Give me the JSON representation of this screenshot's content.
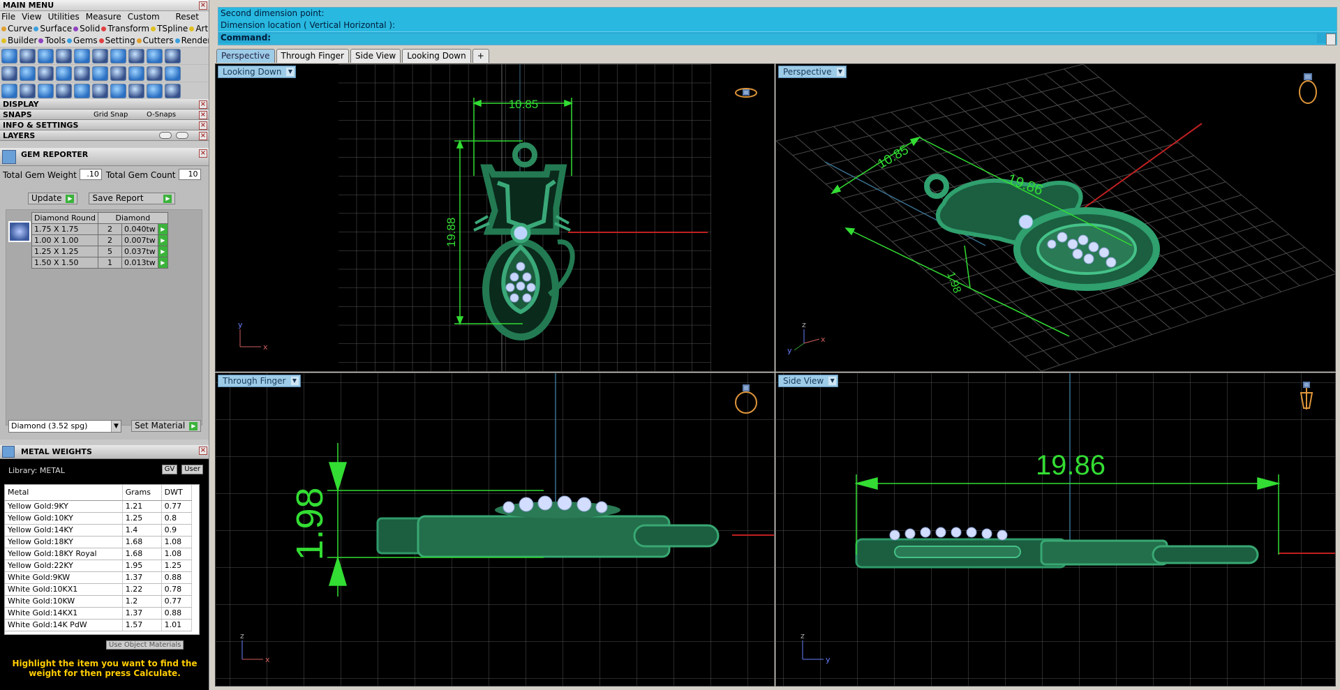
{
  "main_menu": {
    "title": "MAIN MENU",
    "menus": [
      "File",
      "View",
      "Utilities",
      "Measure",
      "Custom"
    ],
    "reset": "Reset",
    "tags_row1": [
      {
        "label": "Curve",
        "color": "#e0a030"
      },
      {
        "label": "Surface",
        "color": "#3aa0e0"
      },
      {
        "label": "Solid",
        "color": "#9040c0"
      },
      {
        "label": "Transform",
        "color": "#e04040"
      },
      {
        "label": "TSpline",
        "color": "#e0c020"
      },
      {
        "label": "Art",
        "color": "#e0c020"
      }
    ],
    "tags_row2": [
      {
        "label": "Builder",
        "color": "#e0c020"
      },
      {
        "label": "Tools",
        "color": "#9040c0"
      },
      {
        "label": "Gems",
        "color": "#3aa0e0"
      },
      {
        "label": "Setting",
        "color": "#e04040"
      },
      {
        "label": "Cutters",
        "color": "#e0a030"
      },
      {
        "label": "Render",
        "color": "#3aa0e0"
      }
    ]
  },
  "sections": {
    "display": "DISPLAY",
    "snaps": "SNAPS",
    "grid_snap": "Grid Snap",
    "o_snaps": "O-Snaps",
    "info": "INFO & SETTINGS",
    "layers": "LAYERS"
  },
  "gem_reporter": {
    "title": "GEM REPORTER",
    "total_weight_label": "Total Gem Weight",
    "total_weight": ".10",
    "total_count_label": "Total Gem Count",
    "total_count": "10",
    "update": "Update",
    "save_report": "Save Report",
    "headers": [
      "Diamond Round",
      "Diamond"
    ],
    "rows": [
      {
        "size": "1.75 X 1.75",
        "count": "2",
        "weight": "0.040tw"
      },
      {
        "size": "1.00 X 1.00",
        "count": "2",
        "weight": "0.007tw"
      },
      {
        "size": "1.25 X 1.25",
        "count": "5",
        "weight": "0.037tw"
      },
      {
        "size": "1.50 X 1.50",
        "count": "1",
        "weight": "0.013tw"
      }
    ],
    "material_select": "Diamond    (3.52 spg)",
    "set_material": "Set Material"
  },
  "metal_weights": {
    "title": "METAL WEIGHTS",
    "library": "Library: METAL",
    "gv": "GV",
    "user": "User",
    "headers": [
      "Metal",
      "Grams",
      "DWT"
    ],
    "rows": [
      [
        "Yellow Gold:9KY",
        "1.21",
        "0.77"
      ],
      [
        "Yellow Gold:10KY",
        "1.25",
        "0.8"
      ],
      [
        "Yellow Gold:14KY",
        "1.4",
        "0.9"
      ],
      [
        "Yellow Gold:18KY",
        "1.68",
        "1.08"
      ],
      [
        "Yellow Gold:18KY Royal",
        "1.68",
        "1.08"
      ],
      [
        "Yellow Gold:22KY",
        "1.95",
        "1.25"
      ],
      [
        "White Gold:9KW",
        "1.37",
        "0.88"
      ],
      [
        "White Gold:10KX1",
        "1.22",
        "0.78"
      ],
      [
        "White Gold:10KW",
        "1.2",
        "0.77"
      ],
      [
        "White Gold:14KX1",
        "1.37",
        "0.88"
      ],
      [
        "White Gold:14K PdW",
        "1.57",
        "1.01"
      ]
    ],
    "use_object": "Use Object Materials",
    "hint": "Highlight the item you want to find the weight for then press Calculate."
  },
  "command": {
    "line1": "Second dimension point:",
    "line2": "Dimension location ( Vertical  Horizontal ):",
    "label": "Command:"
  },
  "tabs": [
    "Perspective",
    "Through Finger",
    "Side View",
    "Looking Down",
    "+"
  ],
  "viewports": {
    "top_left": {
      "label": "Looking Down",
      "dim_w": "10.85",
      "dim_h": "19.88",
      "axis_x": "x",
      "axis_y": "y"
    },
    "top_right": {
      "label": "Perspective",
      "dim_a": "10.85",
      "dim_b": "19.86",
      "dim_c": "1.98",
      "axis_x": "x",
      "axis_y": "y",
      "axis_z": "z"
    },
    "bottom_left": {
      "label": "Through Finger",
      "dim": "1.98",
      "axis_x": "x",
      "axis_z": "z"
    },
    "bottom_right": {
      "label": "Side View",
      "dim": "19.86",
      "axis_y": "y",
      "axis_z": "z"
    }
  }
}
